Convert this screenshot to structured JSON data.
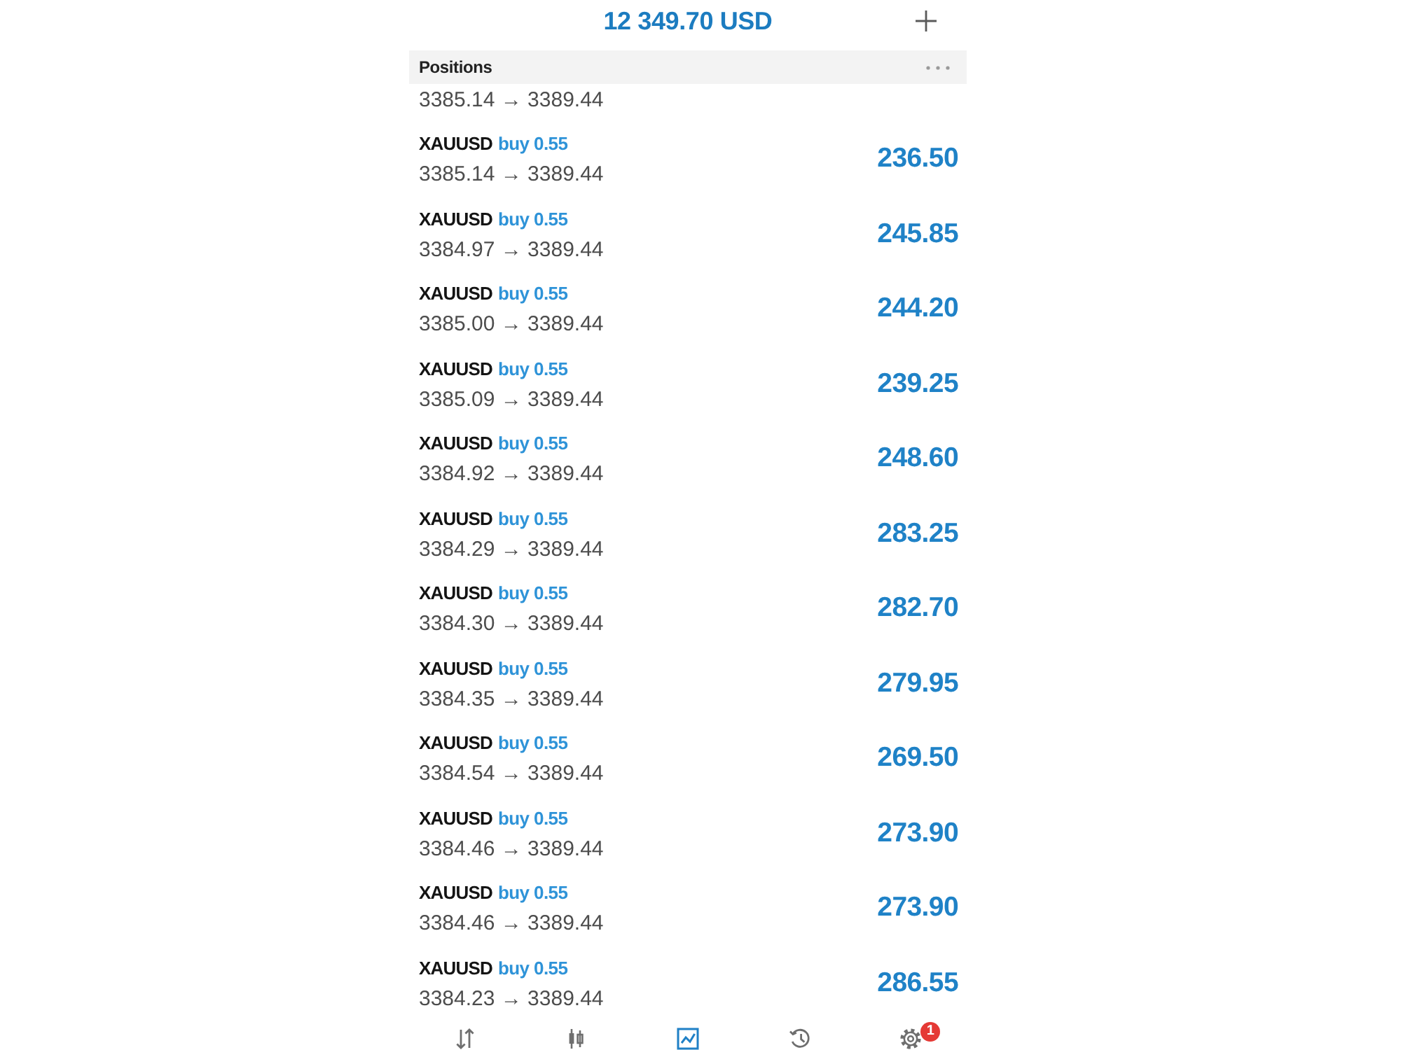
{
  "header": {
    "balance": "12 349.70 USD"
  },
  "positions": {
    "title": "Positions",
    "rows": [
      {
        "prices": "3385.14 → 3389.44"
      },
      {
        "symbol": "XAUUSD",
        "order": "buy 0.55",
        "prices": "3385.14 → 3389.44",
        "profit": "236.50"
      },
      {
        "symbol": "XAUUSD",
        "order": "buy 0.55",
        "prices": "3384.97 → 3389.44",
        "profit": "245.85"
      },
      {
        "symbol": "XAUUSD",
        "order": "buy 0.55",
        "prices": "3385.00 → 3389.44",
        "profit": "244.20"
      },
      {
        "symbol": "XAUUSD",
        "order": "buy 0.55",
        "prices": "3385.09 → 3389.44",
        "profit": "239.25"
      },
      {
        "symbol": "XAUUSD",
        "order": "buy 0.55",
        "prices": "3384.92 → 3389.44",
        "profit": "248.60"
      },
      {
        "symbol": "XAUUSD",
        "order": "buy 0.55",
        "prices": "3384.29 → 3389.44",
        "profit": "283.25"
      },
      {
        "symbol": "XAUUSD",
        "order": "buy 0.55",
        "prices": "3384.30 → 3389.44",
        "profit": "282.70"
      },
      {
        "symbol": "XAUUSD",
        "order": "buy 0.55",
        "prices": "3384.35 → 3389.44",
        "profit": "279.95"
      },
      {
        "symbol": "XAUUSD",
        "order": "buy 0.55",
        "prices": "3384.54 → 3389.44",
        "profit": "269.50"
      },
      {
        "symbol": "XAUUSD",
        "order": "buy 0.55",
        "prices": "3384.46 → 3389.44",
        "profit": "273.90"
      },
      {
        "symbol": "XAUUSD",
        "order": "buy 0.55",
        "prices": "3384.46 → 3389.44",
        "profit": "273.90"
      },
      {
        "symbol": "XAUUSD",
        "order": "buy 0.55",
        "prices": "3384.23 → 3389.44",
        "profit": "286.55"
      }
    ]
  },
  "tab_bar": [
    {
      "kind": "quotes",
      "selected": false
    },
    {
      "kind": "chart",
      "selected": false
    },
    {
      "kind": "trade",
      "selected": true
    },
    {
      "kind": "history",
      "selected": false
    },
    {
      "kind": "settings",
      "selected": false,
      "badge": "1"
    }
  ]
}
